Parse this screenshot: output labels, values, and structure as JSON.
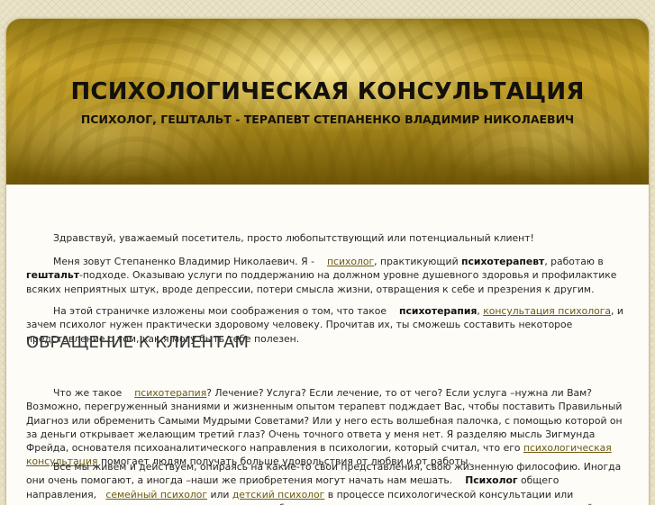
{
  "header": {
    "title": "ПСИХОЛОГИЧЕСКАЯ КОНСУЛЬТАЦИЯ",
    "subtitle": "ПСИХОЛОГ, ГЕШТАЛЬТ - ТЕРАПЕВТ СТЕПАНЕНКО ВЛАДИМИР НИКОЛАЕВИЧ"
  },
  "intro": {
    "p1": "Здравствуй, уважаемый посетитель, просто любопытствующий или потенциальный клиент!",
    "p2": {
      "t1": "Меня зовут Степаненко Владимир Николаевич. Я -",
      "link1": "психолог",
      "t2": ", практикующий",
      "b1": "психотерапевт",
      "t3": ", работаю в",
      "b2": "гештальт",
      "t4": "-подходе. Оказываю услуги по поддержанию на должном уровне душевного здоровья и профилактике всяких неприятных штук, вроде депрессии, потери смысла жизни, отвращения к себе и презрения к другим."
    },
    "p3": {
      "t1": "На этой страничке изложены мои соображения о том, что такое",
      "b1": "психотерапия",
      "t2": ",",
      "link1": "консультация психолога",
      "t3": ", и зачем психолог нужен практически здоровому человеку. Прочитав их, ты сможешь составить некоторое представление о том, как я могу быть тебе полезен."
    }
  },
  "section": {
    "heading": "ОБРАЩЕНИЕ К КЛИЕНТАМ",
    "p1": {
      "t1": "Что же такое",
      "link1": "психотерапия",
      "t2": "? Лечение? Услуга? Если лечение, то от чего? Если услуга –нужна ли Вам? Возможно, перегруженный знаниями и жизненным опытом терапевт подждает Вас, чтобы поставить Правильный Диагноз или обременить Самыми Мудрыми Советами? Или у него есть волшебная палочка, с помощью которой он за деньги открывает желающим третий глаз? Очень точного ответа у меня нет. Я разделяю мысль Зигмунда Фрейда, основателя психоаналитического направления в психологии, который считал, что его",
      "link2": "психологическая консультация",
      "t3": "помогает людям получать больше удовольствия от любви и от работы."
    },
    "p2": {
      "t1": "Все мы живём и действуем, опираясь на какие-то свои представления, свою жизненную философию. Иногда они очень помогают, а иногда –наши же приобретения могут начать нам мешать.",
      "b1": "Психолог",
      "t2": "общего направления,",
      "link1": "семейный психолог",
      "t3": "или",
      "link2": "детский психолог",
      "t4": "в процессе психологической консультации или психотерапии поможет сориентироваться -как обходиться со своими знаниями и опытом или с их нехваткой; как пользоваться собой себе же на радость и во благо; как быть"
    }
  },
  "colors": {
    "header_gold": "#c9a52e",
    "link": "#6b5a12",
    "text": "#262626",
    "content_bg": "#fdfcf7",
    "page_bg": "#e9e3c9"
  }
}
